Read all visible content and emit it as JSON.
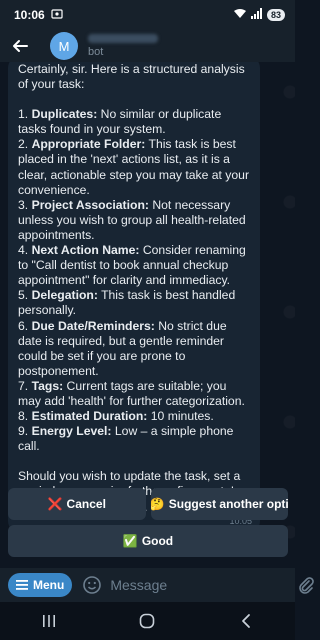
{
  "status_bar": {
    "time": "10:06",
    "battery": "83"
  },
  "header": {
    "avatar_letter": "M",
    "subtitle": "bot"
  },
  "message": {
    "intro": "Certainly, sir. Here is a structured analysis of your task:",
    "items": [
      {
        "num": "1.",
        "title": "Duplicates:",
        "text": " No similar or duplicate tasks found in your system."
      },
      {
        "num": "2.",
        "title": "Appropriate Folder:",
        "text": " This task is best placed in the 'next' actions list, as it is a clear, actionable step you may take at your convenience."
      },
      {
        "num": "3.",
        "title": "Project Association:",
        "text": " Not necessary unless you wish to group all health-related appointments."
      },
      {
        "num": "4.",
        "title": "Next Action Name:",
        "text": " Consider renaming to \"Call dentist to book annual checkup appointment\" for clarity and immediacy."
      },
      {
        "num": "5.",
        "title": "Delegation:",
        "text": " This task is best handled personally."
      },
      {
        "num": "6.",
        "title": "Due Date/Reminders:",
        "text": " No strict due date is required, but a gentle reminder could be set if you are prone to postponement."
      },
      {
        "num": "7.",
        "title": "Tags:",
        "text": " Current tags are suitable; you may add 'health' for further categorization."
      },
      {
        "num": "8.",
        "title": "Estimated Duration:",
        "text": " 10 minutes."
      },
      {
        "num": "9.",
        "title": "Energy Level:",
        "text": " Low – a simple phone call."
      }
    ],
    "outro": "Should you wish to update the task, set a reminder, or require further refinement, I remain at your disposal.",
    "time": "10:05"
  },
  "keyboard": {
    "cancel_emoji": "❌",
    "cancel_label": "Cancel",
    "suggest_emoji": "🤔",
    "suggest_label": "Suggest another opti",
    "good_emoji": "✅",
    "good_label": "Good"
  },
  "input_bar": {
    "menu_label": "Menu",
    "placeholder": "Message"
  },
  "colors": {
    "background": "#0e1621",
    "bubble": "#182533",
    "accent": "#3a87c7",
    "avatar": "#5fa6e6"
  }
}
